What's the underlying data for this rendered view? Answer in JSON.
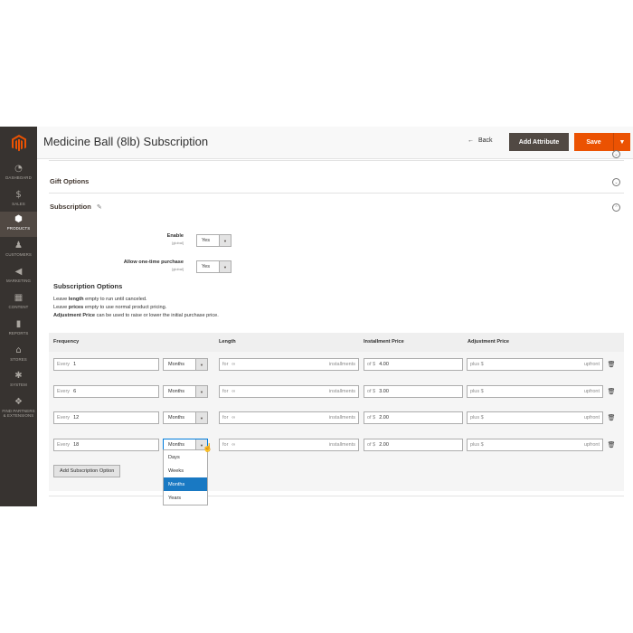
{
  "brand": {
    "accent": "#eb5202",
    "sidebar_bg": "#373330",
    "dark_button": "#514943",
    "selected_option": "#1979c3"
  },
  "sidebar": {
    "logo_icon": "magento-logo-icon",
    "items": [
      {
        "label": "DASHBOARD",
        "icon": "dashboard-icon",
        "glyph": "◔"
      },
      {
        "label": "SALES",
        "icon": "dollar-icon",
        "glyph": "$"
      },
      {
        "label": "PRODUCTS",
        "icon": "box-icon",
        "glyph": "⬢"
      },
      {
        "label": "CUSTOMERS",
        "icon": "person-icon",
        "glyph": "♟"
      },
      {
        "label": "MARKETING",
        "icon": "megaphone-icon",
        "glyph": "◀"
      },
      {
        "label": "CONTENT",
        "icon": "layout-icon",
        "glyph": "▦"
      },
      {
        "label": "REPORTS",
        "icon": "bar-chart-icon",
        "glyph": "▮"
      },
      {
        "label": "STORES",
        "icon": "storefront-icon",
        "glyph": "⌂"
      },
      {
        "label": "SYSTEM",
        "icon": "gear-icon",
        "glyph": "✱"
      },
      {
        "label": "FIND PARTNERS & EXTENSIONS",
        "icon": "cubes-icon",
        "glyph": "❖"
      }
    ]
  },
  "header": {
    "title": "Medicine Ball (8lb) Subscription",
    "back_label": "Back",
    "back_arrow": "←",
    "add_attribute_label": "Add Attribute",
    "save_label": "Save",
    "save_toggle": "▼"
  },
  "sections": {
    "gift_options": "Gift Options",
    "subscription": "Subscription",
    "chevron_down": "⌄",
    "chevron_up": "⌃",
    "pencil": "✎"
  },
  "fields": {
    "enable": {
      "label": "Enable",
      "scope": "[global]",
      "value": "Yes"
    },
    "one_time": {
      "label": "Allow one-time purchase",
      "scope": "[global]",
      "value": "Yes"
    }
  },
  "subscription_options": {
    "heading": "Subscription Options",
    "help": [
      {
        "pre": "Leave ",
        "bold": "length",
        "post": " empty to run until canceled."
      },
      {
        "pre": "Leave ",
        "bold": "prices",
        "post": " empty to use normal product pricing."
      },
      {
        "pre": "",
        "bold": "Adjustment Price",
        "post": " can be used to raise or lower the initial purchase price."
      }
    ]
  },
  "table": {
    "headers": {
      "frequency": "Frequency",
      "length": "Length",
      "installment": "Installment Price",
      "adjustment": "Adjustment Price"
    },
    "rows": [
      {
        "every_prefix": "Every",
        "every": "1",
        "unit": "Months",
        "for_prefix": "for",
        "length": "∞",
        "length_suffix": "installments",
        "of_prefix": "of $",
        "installment": "4.00",
        "plus_prefix": "plus $",
        "upfront": "upfront"
      },
      {
        "every_prefix": "Every",
        "every": "6",
        "unit": "Months",
        "for_prefix": "for",
        "length": "∞",
        "length_suffix": "installments",
        "of_prefix": "of $",
        "installment": "3.00",
        "plus_prefix": "plus $",
        "upfront": "upfront"
      },
      {
        "every_prefix": "Every",
        "every": "12",
        "unit": "Months",
        "for_prefix": "for",
        "length": "∞",
        "length_suffix": "installments",
        "of_prefix": "of $",
        "installment": "2.00",
        "plus_prefix": "plus $",
        "upfront": "upfront"
      },
      {
        "every_prefix": "Every",
        "every": "18",
        "unit": "Months",
        "for_prefix": "for",
        "length": "∞",
        "length_suffix": "installments",
        "of_prefix": "of $",
        "installment": "2.00",
        "plus_prefix": "plus $",
        "upfront": "upfront"
      }
    ],
    "add_button": "Add Subscription Option"
  },
  "dropdown": {
    "options": [
      "Days",
      "Weeks",
      "Months",
      "Years"
    ],
    "selected": "Months"
  }
}
